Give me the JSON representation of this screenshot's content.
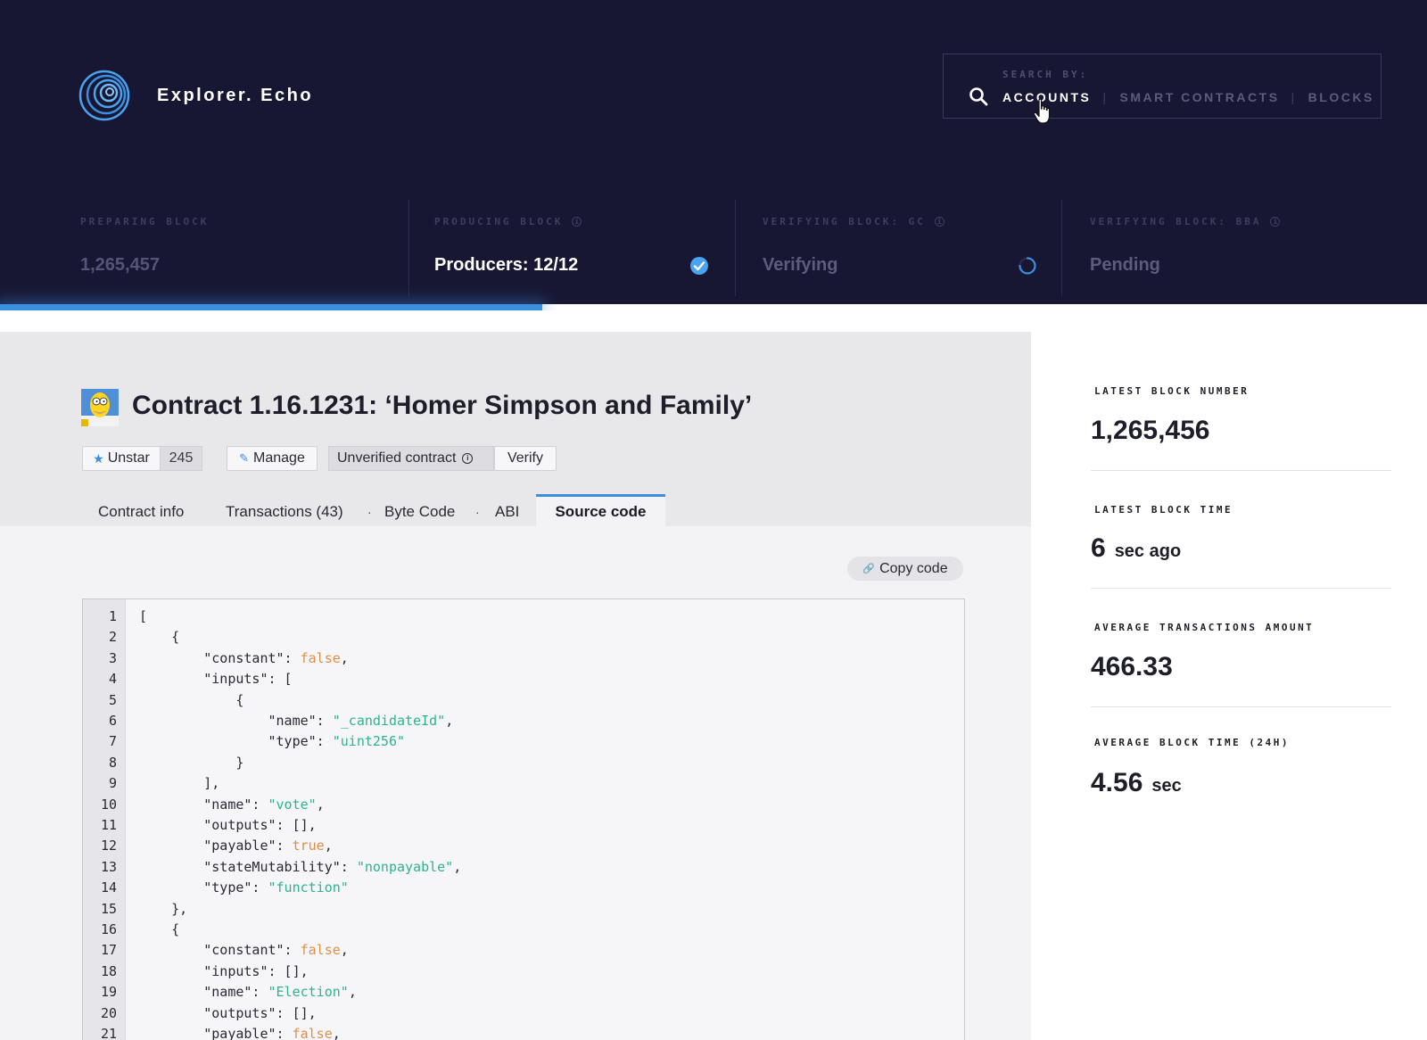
{
  "header": {
    "brand": "Explorer. Echo",
    "search": {
      "label": "SEARCH BY:",
      "options": [
        "ACCOUNTS",
        "SMART CONTRACTS",
        "BLOCKS"
      ],
      "active": "ACCOUNTS",
      "separator": "|"
    },
    "stages": [
      {
        "label": "PREPARING BLOCK",
        "value": "1,265,457",
        "value_color": "#55557a",
        "has_info": false,
        "status": "none"
      },
      {
        "label": "PRODUCING BLOCK",
        "value": "Producers: 12/12",
        "value_color": "#ffffff",
        "has_info": true,
        "status": "check-circle-icon"
      },
      {
        "label": "VERIFYING BLOCK: GC",
        "value": "Verifying",
        "value_color": "#5c5c7c",
        "has_info": true,
        "status": "spinner-icon"
      },
      {
        "label": "VERIFYING BLOCK: BBA",
        "value": "Pending",
        "value_color": "#5c5c7c",
        "has_info": true,
        "status": "none"
      }
    ],
    "progress_fraction": 0.38,
    "colors": {
      "bg": "#181733",
      "accent": "#3b8fe0"
    }
  },
  "contract": {
    "title": "Contract 1.16.1231: ‘Homer Simpson and Family’",
    "unstar_label": "Unstar",
    "star_count": "245",
    "manage_label": "Manage",
    "unverified_label": "Unverified contract",
    "verify_label": "Verify"
  },
  "tabs": [
    {
      "label": "Contract info",
      "active": false
    },
    {
      "label": "Transactions (43)",
      "active": false
    },
    {
      "label": "Byte Code",
      "active": false
    },
    {
      "label": "ABI",
      "active": false
    },
    {
      "label": "Source code",
      "active": true
    }
  ],
  "tab_separator": "·",
  "copy_label": "Copy code",
  "code_lines": [
    [
      {
        "t": "["
      }
    ],
    [
      {
        "t": "    {"
      }
    ],
    [
      {
        "t": "        \"constant\": "
      },
      {
        "t": "false",
        "c": "bool"
      },
      {
        "t": ","
      }
    ],
    [
      {
        "t": "        \"inputs\": ["
      }
    ],
    [
      {
        "t": "            {"
      }
    ],
    [
      {
        "t": "                \"name\": "
      },
      {
        "t": "\"_candidateId\"",
        "c": "str"
      },
      {
        "t": ","
      }
    ],
    [
      {
        "t": "                \"type\": "
      },
      {
        "t": "\"uint256\"",
        "c": "str"
      }
    ],
    [
      {
        "t": "            }"
      }
    ],
    [
      {
        "t": "        ],"
      }
    ],
    [
      {
        "t": "        \"name\": "
      },
      {
        "t": "\"vote\"",
        "c": "str"
      },
      {
        "t": ","
      }
    ],
    [
      {
        "t": "        \"outputs\": [],"
      }
    ],
    [
      {
        "t": "        \"payable\": "
      },
      {
        "t": "true",
        "c": "bool"
      },
      {
        "t": ","
      }
    ],
    [
      {
        "t": "        \"stateMutability\": "
      },
      {
        "t": "\"nonpayable\"",
        "c": "str"
      },
      {
        "t": ","
      }
    ],
    [
      {
        "t": "        \"type\": "
      },
      {
        "t": "\"function\"",
        "c": "str"
      }
    ],
    [
      {
        "t": "    },"
      }
    ],
    [
      {
        "t": "    {"
      }
    ],
    [
      {
        "t": "        \"constant\": "
      },
      {
        "t": "false",
        "c": "bool"
      },
      {
        "t": ","
      }
    ],
    [
      {
        "t": "        \"inputs\": [],"
      }
    ],
    [
      {
        "t": "        \"name\": "
      },
      {
        "t": "\"Election\"",
        "c": "str"
      },
      {
        "t": ","
      }
    ],
    [
      {
        "t": "        \"outputs\": [],"
      }
    ],
    [
      {
        "t": "        \"payable\": "
      },
      {
        "t": "false",
        "c": "bool"
      },
      {
        "t": ","
      }
    ]
  ],
  "stats": [
    {
      "label": "LATEST BLOCK NUMBER",
      "value": "1,265,456",
      "unit": ""
    },
    {
      "label": "LATEST BLOCK TIME",
      "value": "6",
      "unit": "sec ago"
    },
    {
      "label": "AVERAGE TRANSACTIONS AMOUNT",
      "value": "466.33",
      "unit": ""
    },
    {
      "label": "AVERAGE BLOCK TIME (24H)",
      "value": "4.56",
      "unit": "sec"
    }
  ]
}
